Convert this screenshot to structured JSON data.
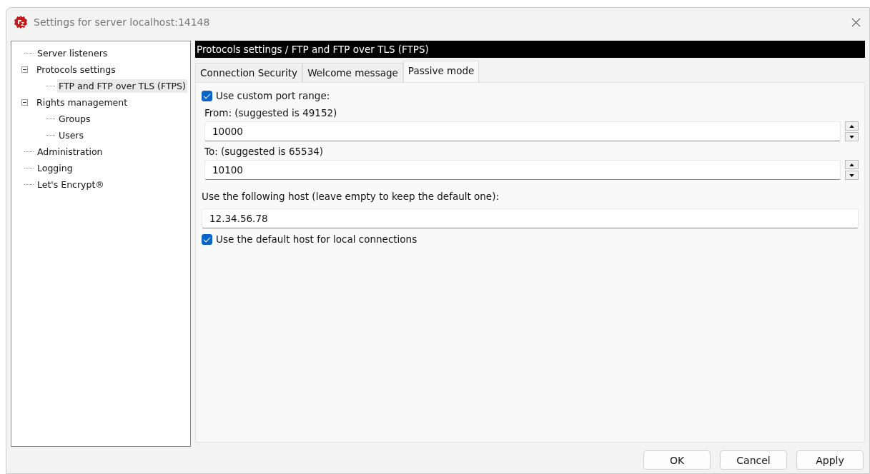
{
  "window": {
    "title": "Settings for server localhost:14148"
  },
  "tree": [
    {
      "label": "Server listeners",
      "selected": false
    },
    {
      "label": "Protocols settings",
      "selected": false,
      "expanded": true,
      "children": [
        {
          "label": "FTP and FTP over TLS (FTPS)",
          "selected": true
        }
      ]
    },
    {
      "label": "Rights management",
      "selected": false,
      "expanded": true,
      "children": [
        {
          "label": "Groups",
          "selected": false
        },
        {
          "label": "Users",
          "selected": false
        }
      ]
    },
    {
      "label": "Administration",
      "selected": false
    },
    {
      "label": "Logging",
      "selected": false
    },
    {
      "label": "Let's Encrypt®",
      "selected": false
    }
  ],
  "header": "Protocols settings / FTP and FTP over TLS (FTPS)",
  "tabs": [
    {
      "label": "Connection Security",
      "selected": false
    },
    {
      "label": "Welcome message",
      "selected": false
    },
    {
      "label": "Passive mode",
      "selected": true
    }
  ],
  "custom_port_range": {
    "label": "Use custom port range:",
    "checked": true
  },
  "from": {
    "label": "From: (suggested is 49152)",
    "value": "10000"
  },
  "to": {
    "label": "To: (suggested is 65534)",
    "value": "10100"
  },
  "host": {
    "label": "Use the following host (leave empty to keep the default one):",
    "value": "12.34.56.78"
  },
  "default_host_local": {
    "label": "Use the default host for local connections",
    "checked": true
  },
  "buttons": [
    "OK",
    "Cancel",
    "Apply"
  ]
}
